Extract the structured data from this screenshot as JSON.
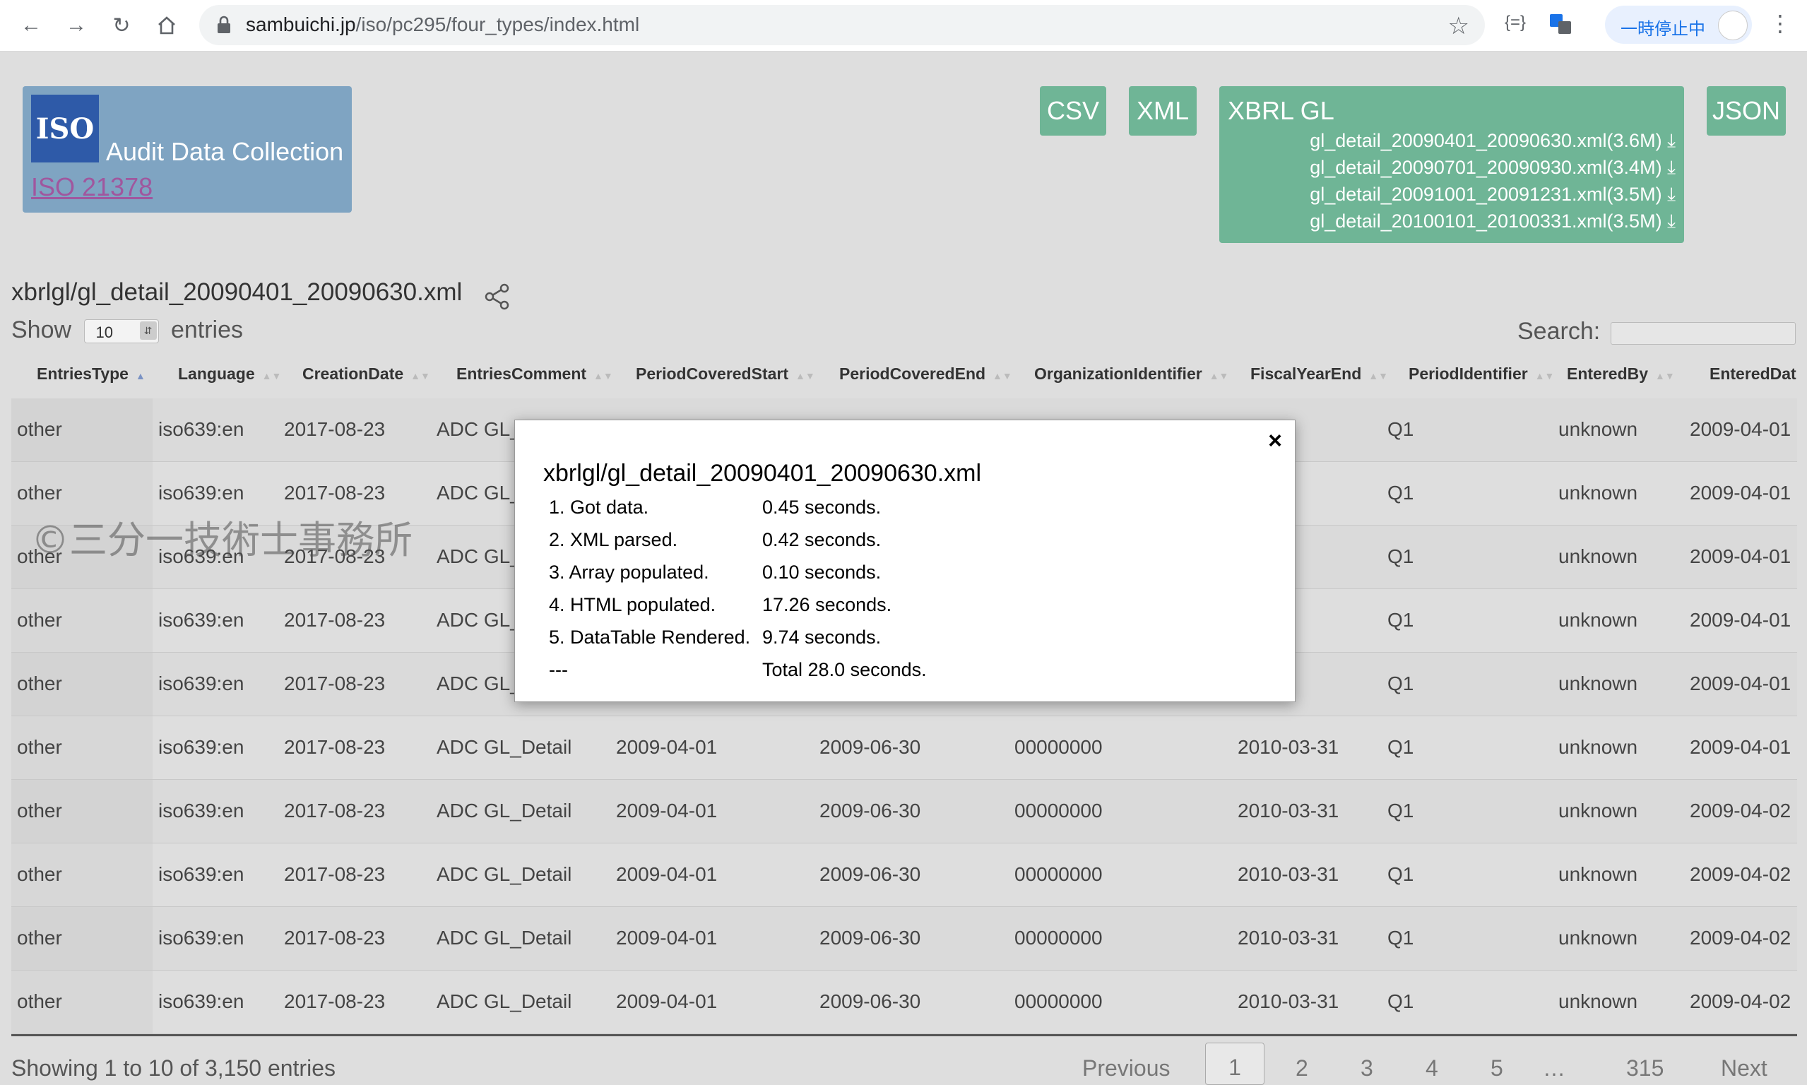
{
  "browser": {
    "url_host": "sambuichi.jp",
    "url_path": "/iso/pc295/four_types/index.html",
    "extension_1": "{=}",
    "pause_label": "一時停止中"
  },
  "logo": {
    "badge_text": "ISO",
    "title": "Audit Data Collection",
    "link": "ISO 21378"
  },
  "formats": {
    "csv": "CSV",
    "xml": "XML",
    "xbrl": "XBRL GL",
    "json": "JSON",
    "xbrl_files": [
      "gl_detail_20090401_20090630.xml(3.6M)",
      "gl_detail_20090701_20090930.xml(3.4M)",
      "gl_detail_20091001_20091231.xml(3.5M)",
      "gl_detail_20100101_20100331.xml(3.5M)"
    ]
  },
  "file_title": "xbrlgl/gl_detail_20090401_20090630.xml",
  "controls": {
    "show": "Show",
    "page_length": "10",
    "entries": "entries",
    "search_label": "Search:"
  },
  "columns": [
    "EntriesType",
    "Language",
    "CreationDate",
    "EntriesComment",
    "PeriodCoveredStart",
    "PeriodCoveredEnd",
    "OrganizationIdentifier",
    "FiscalYearEnd",
    "PeriodIdentifier",
    "EnteredBy",
    "EnteredDat"
  ],
  "rows": [
    [
      "other",
      "iso639:en",
      "2017-08-23",
      "ADC GL_",
      "",
      "",
      "",
      "3-31",
      "Q1",
      "unknown",
      "2009-04-01"
    ],
    [
      "other",
      "iso639:en",
      "2017-08-23",
      "ADC GL_",
      "",
      "",
      "",
      "3-31",
      "Q1",
      "unknown",
      "2009-04-01"
    ],
    [
      "other",
      "iso639:en",
      "2017-08-23",
      "ADC GL_",
      "",
      "",
      "",
      "3-31",
      "Q1",
      "unknown",
      "2009-04-01"
    ],
    [
      "other",
      "iso639:en",
      "2017-08-23",
      "ADC GL_",
      "",
      "",
      "",
      "3-31",
      "Q1",
      "unknown",
      "2009-04-01"
    ],
    [
      "other",
      "iso639:en",
      "2017-08-23",
      "ADC GL_",
      "",
      "",
      "",
      "3-31",
      "Q1",
      "unknown",
      "2009-04-01"
    ],
    [
      "other",
      "iso639:en",
      "2017-08-23",
      "ADC GL_Detail",
      "2009-04-01",
      "2009-06-30",
      "00000000",
      "2010-03-31",
      "Q1",
      "unknown",
      "2009-04-01"
    ],
    [
      "other",
      "iso639:en",
      "2017-08-23",
      "ADC GL_Detail",
      "2009-04-01",
      "2009-06-30",
      "00000000",
      "2010-03-31",
      "Q1",
      "unknown",
      "2009-04-02"
    ],
    [
      "other",
      "iso639:en",
      "2017-08-23",
      "ADC GL_Detail",
      "2009-04-01",
      "2009-06-30",
      "00000000",
      "2010-03-31",
      "Q1",
      "unknown",
      "2009-04-02"
    ],
    [
      "other",
      "iso639:en",
      "2017-08-23",
      "ADC GL_Detail",
      "2009-04-01",
      "2009-06-30",
      "00000000",
      "2010-03-31",
      "Q1",
      "unknown",
      "2009-04-02"
    ],
    [
      "other",
      "iso639:en",
      "2017-08-23",
      "ADC GL_Detail",
      "2009-04-01",
      "2009-06-30",
      "00000000",
      "2010-03-31",
      "Q1",
      "unknown",
      "2009-04-02"
    ]
  ],
  "watermark": "©三分一技術士事務所",
  "footer": {
    "info": "Showing 1 to 10 of 3,150 entries",
    "previous": "Previous",
    "pages": [
      "1",
      "2",
      "3",
      "4",
      "5"
    ],
    "ellipsis": "…",
    "last": "315",
    "next": "Next"
  },
  "modal": {
    "title": "xbrlgl/gl_detail_20090401_20090630.xml",
    "close": "×",
    "steps": [
      {
        "label": "1. Got data.",
        "time": "0.45 seconds."
      },
      {
        "label": "2. XML parsed.",
        "time": "0.42 seconds."
      },
      {
        "label": "3. Array populated.",
        "time": "0.10 seconds."
      },
      {
        "label": "4. HTML populated.",
        "time": "17.26 seconds."
      },
      {
        "label": "5. DataTable Rendered.",
        "time": "9.74 seconds."
      },
      {
        "label": "---",
        "time": "Total 28.0 seconds."
      }
    ]
  }
}
